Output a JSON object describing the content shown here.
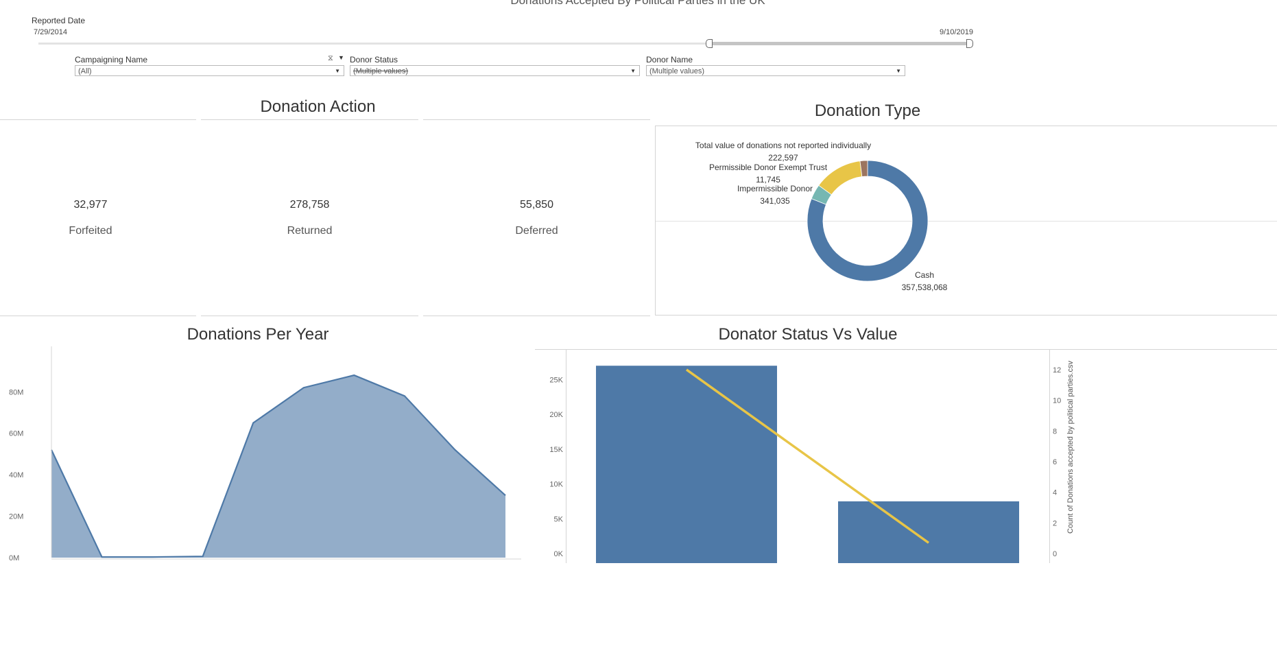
{
  "dashboard": {
    "title": "Donations Accepted By Political Parties in the UK"
  },
  "filters": {
    "reported_date": {
      "label": "Reported Date",
      "start": "7/29/2014",
      "end": "9/10/2019"
    },
    "campaigning_name": {
      "label": "Campaigning Name",
      "value": "(All)"
    },
    "donor_status": {
      "label": "Donor Status",
      "value": "(Multiple values)"
    },
    "donor_name": {
      "label": "Donor Name",
      "value": "(Multiple values)"
    }
  },
  "donation_action": {
    "title": "Donation Action",
    "kpis": [
      {
        "value": "32,977",
        "label": "Forfeited"
      },
      {
        "value": "278,758",
        "label": "Returned"
      },
      {
        "value": "55,850",
        "label": "Deferred"
      }
    ]
  },
  "colors": {
    "blue": "#4e79a7",
    "blue_area": "#93adc9",
    "yellow": "#e8c547",
    "teal": "#76b7b2",
    "brown": "#9c755f",
    "red": "#e15759",
    "axis_text": "#666666",
    "grid": "#e6e6e6"
  },
  "chart_data": [
    {
      "type": "pie",
      "title": "Donation Type",
      "slices": [
        {
          "label": "Cash",
          "value": 357538068,
          "value_label": "357,538,068",
          "color": "#4e79a7"
        },
        {
          "label": "Impermissible Donor",
          "value": 341035,
          "value_label": "341,035",
          "color": "#76b7b2"
        },
        {
          "label": "Permissible Donor Exempt Trust",
          "value": 11745,
          "value_label": "11,745",
          "color": "#e15759"
        },
        {
          "label": "Total value of donations not reported individually",
          "value": 222597,
          "value_label": "222,597",
          "color": "#9c755f"
        }
      ],
      "note": "donut chart"
    },
    {
      "type": "area",
      "title": "Donations Per Year",
      "x": [
        1,
        2,
        3,
        4,
        5,
        6,
        7,
        8,
        9,
        10
      ],
      "values": [
        52,
        0.3,
        0.3,
        0.6,
        65,
        82,
        88,
        78,
        52,
        30
      ],
      "y_ticks": [
        "0M",
        "20M",
        "40M",
        "60M",
        "80M"
      ],
      "ylim": [
        0,
        92
      ],
      "y_unit": "M"
    },
    {
      "type": "bar",
      "title": "Donator Status Vs Value",
      "categories": [
        "",
        ""
      ],
      "values": [
        27000,
        7500
      ],
      "line_values": [
        12,
        0.7
      ],
      "y_ticks_left": [
        "0K",
        "5K",
        "10K",
        "15K",
        "20K",
        "25K"
      ],
      "ylim_left": [
        0,
        28500
      ],
      "y_ticks_right": [
        "0",
        "2",
        "4",
        "6",
        "8",
        "10",
        "12"
      ],
      "ylim_right": [
        0,
        12.4
      ],
      "ylabel_right": "Count of Donations accepted by political parties.csv"
    }
  ]
}
